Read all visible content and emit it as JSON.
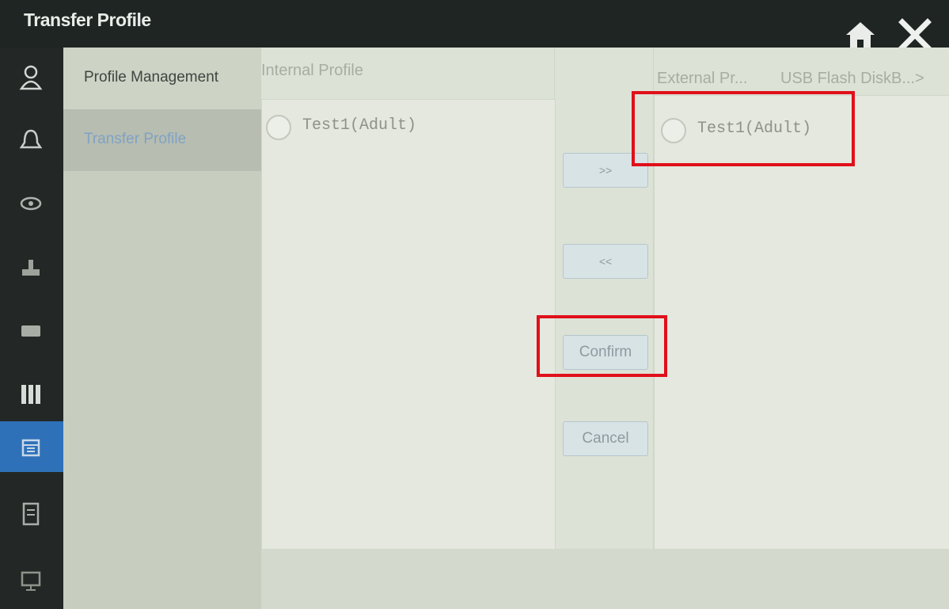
{
  "window": {
    "title": "Transfer Profile"
  },
  "icons": {
    "home": "home-icon",
    "close": "close-icon",
    "rail": [
      "user-icon",
      "bell-icon",
      "eye-icon",
      "ventilator-icon",
      "battery-icon",
      "bars-icon",
      "calendar-icon",
      "report-icon",
      "monitor-icon"
    ]
  },
  "nav": {
    "items": [
      {
        "label": "Profile Management",
        "active": false
      },
      {
        "label": "Transfer Profile",
        "active": true
      }
    ]
  },
  "internal": {
    "title": "Internal Profile",
    "items": [
      {
        "label": "Test1(Adult)"
      }
    ]
  },
  "external": {
    "title": "External Pr...",
    "source": "USB Flash DiskB...>",
    "items": [
      {
        "label": "Test1(Adult)"
      }
    ]
  },
  "buttons": {
    "move_right": ">>",
    "move_left": "<<",
    "confirm": "Confirm",
    "cancel": "Cancel"
  },
  "colors": {
    "accent": "#2f71b8",
    "annotation": "#e0101a",
    "active_nav_text": "#7fa2c6"
  }
}
